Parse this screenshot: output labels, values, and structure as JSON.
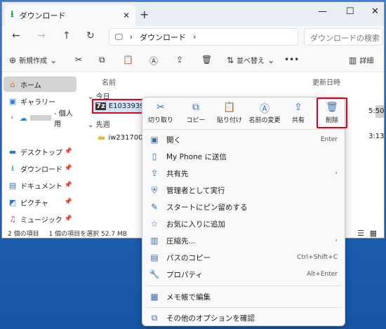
{
  "tab": {
    "title": "ダウンロード"
  },
  "address": {
    "path": "ダウンロード",
    "search_placeholder": "ダウンロードの検索"
  },
  "toolbar": {
    "new_label": "新規作成",
    "sort_label": "並べ替え",
    "details_label": "詳細"
  },
  "sidebar": {
    "items": [
      {
        "label": "ホーム",
        "icon": "home-icon"
      },
      {
        "label": "ギャラリー",
        "icon": "gallery-icon"
      },
      {
        "label": "- 個人用",
        "icon": "onedrive-icon"
      },
      {
        "label": "デスクトップ",
        "icon": "desktop-icon"
      },
      {
        "label": "ダウンロード",
        "icon": "download-icon"
      },
      {
        "label": "ドキュメント",
        "icon": "document-icon"
      },
      {
        "label": "ピクチャ",
        "icon": "picture-icon"
      },
      {
        "label": "ミュージック",
        "icon": "music-icon"
      }
    ]
  },
  "content": {
    "col_name": "名前",
    "col_date": "更新日時",
    "group_today": "今日",
    "group_lastweek": "先週",
    "file1": {
      "name": "E1033939",
      "time": "5:50"
    },
    "file2": {
      "name": "iw2317001w",
      "time": "3:13"
    }
  },
  "status": {
    "count": "2 個の項目",
    "selected": "1 個の項目を選択  52.7 MB"
  },
  "menu": {
    "quick": [
      {
        "label": "切り取り",
        "icon": "scissors-icon"
      },
      {
        "label": "コピー",
        "icon": "copy-icon"
      },
      {
        "label": "貼り付け",
        "icon": "paste-icon"
      },
      {
        "label": "名前の変更",
        "icon": "rename-icon"
      },
      {
        "label": "共有",
        "icon": "share-icon"
      },
      {
        "label": "削除",
        "icon": "trash-icon"
      }
    ],
    "items": [
      {
        "label": "開く",
        "shortcut": "Enter"
      },
      {
        "label": "My Phone に送信",
        "shortcut": ""
      },
      {
        "label": "共有先",
        "shortcut": "›"
      },
      {
        "label": "管理者として実行",
        "shortcut": ""
      },
      {
        "label": "スタートにピン留めする",
        "shortcut": ""
      },
      {
        "label": "お気に入りに追加",
        "shortcut": ""
      },
      {
        "label": "圧縮先...",
        "shortcut": "›"
      },
      {
        "label": "パスのコピー",
        "shortcut": "Ctrl+Shift+C"
      },
      {
        "label": "プロパティ",
        "shortcut": "Alt+Enter"
      },
      {
        "label": "メモ帳で編集",
        "shortcut": ""
      },
      {
        "label": "その他のオプションを確認",
        "shortcut": ""
      }
    ]
  }
}
